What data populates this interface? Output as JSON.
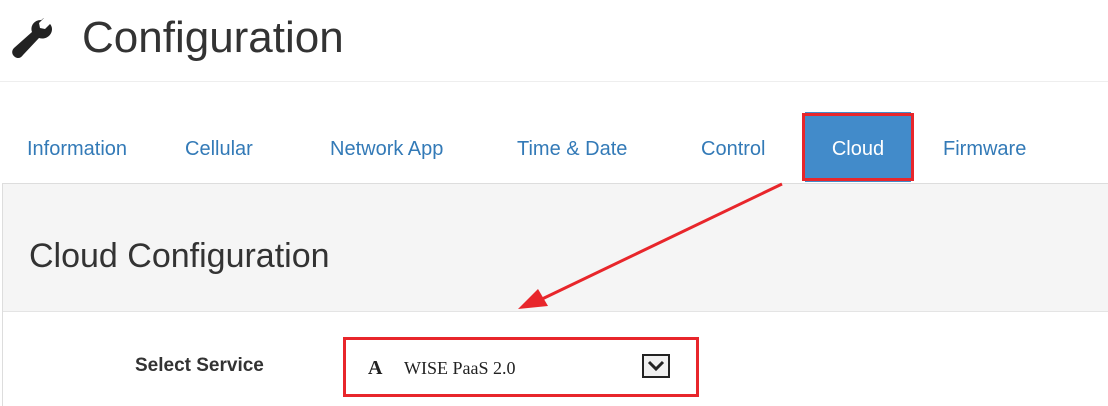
{
  "header": {
    "icon": "wrench-icon",
    "title": "Configuration"
  },
  "tabs": [
    {
      "label": "Information",
      "active": false
    },
    {
      "label": "Cellular",
      "active": false
    },
    {
      "label": "Network App",
      "active": false
    },
    {
      "label": "Time & Date",
      "active": false
    },
    {
      "label": "Control",
      "active": false
    },
    {
      "label": "Cloud",
      "active": true
    },
    {
      "label": "Firmware",
      "active": false
    }
  ],
  "panel": {
    "title": "Cloud Configuration"
  },
  "form": {
    "select_service": {
      "label": "Select Service",
      "icon_glyph": "A",
      "value": "WISE PaaS 2.0"
    }
  },
  "colors": {
    "accent": "#428bca",
    "link": "#337ab7",
    "highlight": "#e8262b"
  }
}
